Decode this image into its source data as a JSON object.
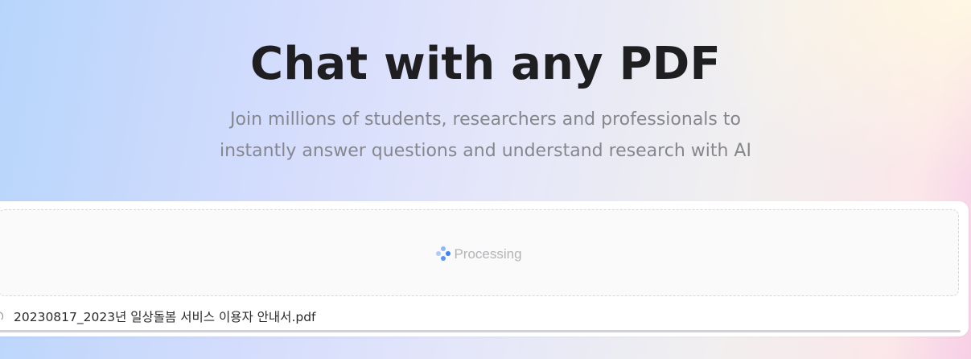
{
  "hero": {
    "title": "Chat with any PDF",
    "subtitle_line1": "Join millions of students, researchers and professionals to",
    "subtitle_line2": "instantly answer questions and understand research with AI"
  },
  "upload": {
    "status_text": "Processing",
    "status_icon": "loading-dots-icon",
    "accent_color": "#3b82f6",
    "file": {
      "name": "20230817_2023년 일상돌봄 서비스 이용자 안내서.pdf",
      "status_icon": "loading-spinner-icon",
      "progress_percent": 100
    }
  }
}
